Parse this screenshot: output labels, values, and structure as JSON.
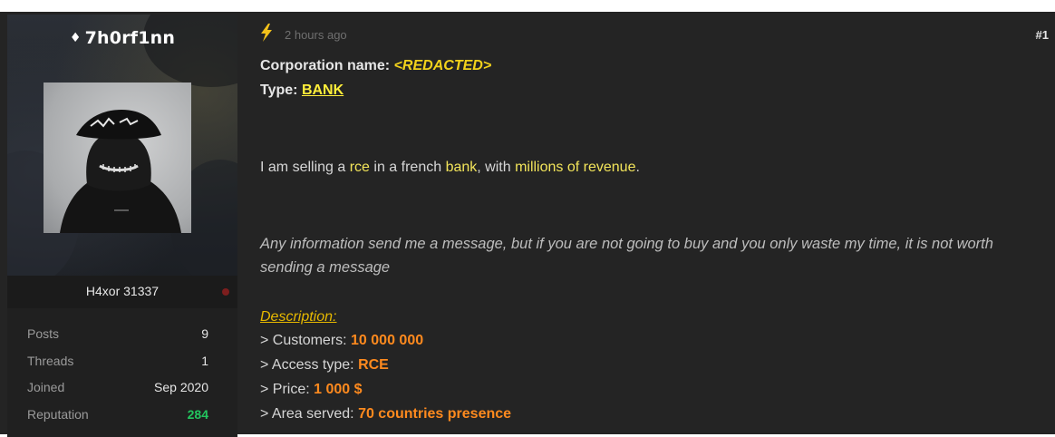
{
  "user": {
    "username": "7h0rf1nn",
    "badge_icon": "diamond-icon",
    "rank": "H4xor 31337",
    "status_color": "#7d1e1e",
    "stats": [
      {
        "label": "Posts",
        "value": "9"
      },
      {
        "label": "Threads",
        "value": "1"
      },
      {
        "label": "Joined",
        "value": "Sep 2020"
      },
      {
        "label": "Reputation",
        "value": "284"
      }
    ]
  },
  "post": {
    "icon": "lightning-bolt-icon",
    "time": "2 hours ago",
    "number": "#1",
    "corp_label": "Corporation name:",
    "corp_value": "<REDACTED>",
    "type_label": "Type:",
    "type_value": "BANK",
    "intro": {
      "p1": "I am selling a ",
      "h1": "rce",
      "p2": " in a french ",
      "h2": "bank",
      "p3": ", with ",
      "h3": "millions of revenue",
      "p4": "."
    },
    "note": "Any information send me a message, but if you are not going to buy and you only waste my time, it is not worth sending a message",
    "description_title": "Description:",
    "items": [
      {
        "label": "> Customers: ",
        "value": "10 000 000"
      },
      {
        "label": "> Access type: ",
        "value": "RCE"
      },
      {
        "label": "> Price: ",
        "value": "1 000 $"
      },
      {
        "label": "> Area served: ",
        "value": "70 countries presence"
      }
    ]
  },
  "colors": {
    "highlight_yellow": "#f2e45a",
    "value_orange": "#ff8a1e",
    "reputation_green": "#22c55e",
    "description_gold": "#e6b800"
  }
}
